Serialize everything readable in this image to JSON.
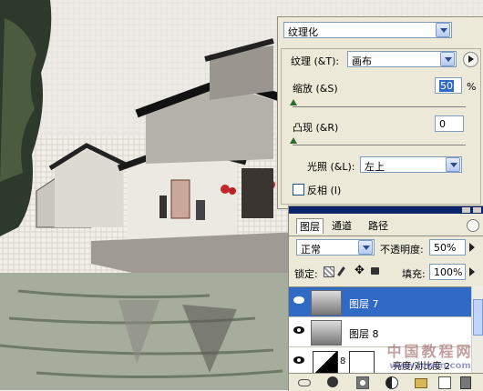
{
  "texture_dialog": {
    "filter_name": "纹理化",
    "texture_label": "纹理 (&T):",
    "texture_value": "画布",
    "scaling_label": "缩放 (&S)",
    "scaling_value": "50",
    "scaling_unit": "%",
    "scaling_fraction": 0.5,
    "relief_label": "凸现 (&R)",
    "relief_value": "0",
    "light_label": "光照 (&L):",
    "light_value": "左上",
    "invert_label": "反相 (I)",
    "invert_checked": false
  },
  "layers_panel": {
    "tabs": [
      "图层",
      "通道",
      "路径"
    ],
    "blend_mode": "正常",
    "opacity_label": "不透明度:",
    "opacity_value": "50%",
    "lock_label": "锁定:",
    "fill_label": "填充:",
    "fill_value": "100%",
    "layers": [
      {
        "name": "图层 7",
        "selected": true
      },
      {
        "name": "图层 8",
        "selected": false
      },
      {
        "name": "亮度/对比度 2",
        "selected": false
      }
    ]
  },
  "watermark": {
    "line1": "中国教程网",
    "line2": "www.jcwcn.com"
  },
  "colors": {
    "selection": "#316ac5",
    "panel": "#ece9d8",
    "tab_bar": "#0a246a"
  }
}
